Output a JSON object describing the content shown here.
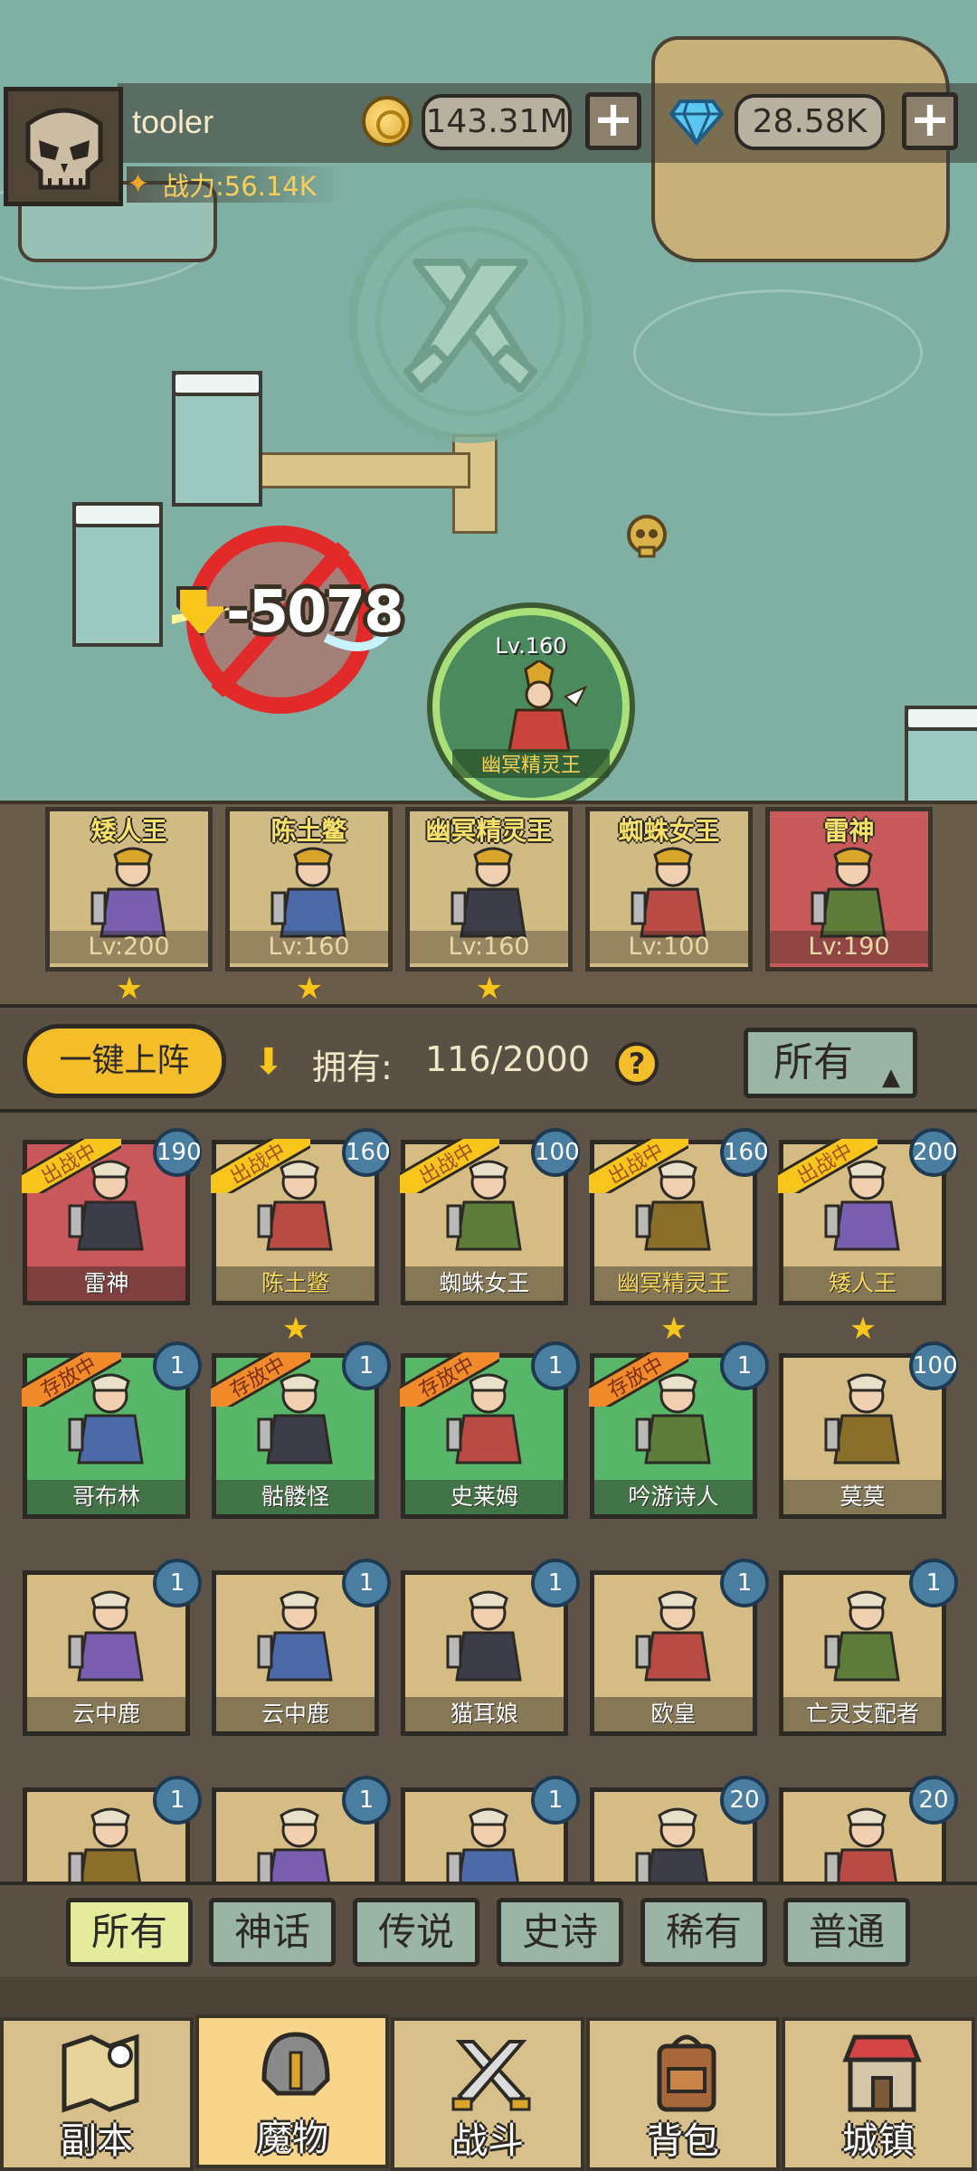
{
  "player": {
    "name": "tooler",
    "power_label": "战力:56.14K",
    "gold": "143.31M",
    "gems": "28.58K"
  },
  "battle": {
    "damage": "-5078",
    "enemy_level": "Lv.160",
    "enemy_name": "幽冥精灵王"
  },
  "team": [
    {
      "name": "矮人王",
      "level": "Lv:200",
      "color": "#d1bb84",
      "star": true
    },
    {
      "name": "陈土鳖",
      "level": "Lv:160",
      "color": "#d1bb84",
      "star": true
    },
    {
      "name": "幽冥精灵王",
      "level": "Lv:160",
      "color": "#d1bb84",
      "star": true
    },
    {
      "name": "蜘蛛女王",
      "level": "Lv:100",
      "color": "#d1bb84",
      "star": false
    },
    {
      "name": "雷神",
      "level": "Lv:190",
      "color": "#c95a5c",
      "star": false
    }
  ],
  "toolbar": {
    "deploy_label": "一键上阵",
    "own_label": "拥有:",
    "own_count": "116/2000",
    "help": "?",
    "filter_label": "所有"
  },
  "roster": [
    {
      "name": "雷神",
      "level": "190",
      "status": "出战中",
      "color": "red",
      "star": false
    },
    {
      "name": "陈土鳖",
      "level": "160",
      "status": "出战中",
      "color": "gold",
      "star": true,
      "gold_name": true
    },
    {
      "name": "蜘蛛女王",
      "level": "100",
      "status": "出战中",
      "color": "gold",
      "star": false
    },
    {
      "name": "幽冥精灵王",
      "level": "160",
      "status": "出战中",
      "color": "gold",
      "star": true,
      "gold_name": true
    },
    {
      "name": "矮人王",
      "level": "200",
      "status": "出战中",
      "color": "gold",
      "star": true,
      "gold_name": true
    },
    {
      "name": "哥布林",
      "level": "1",
      "status": "存放中",
      "color": "green",
      "star": false
    },
    {
      "name": "骷髅怪",
      "level": "1",
      "status": "存放中",
      "color": "green",
      "star": false
    },
    {
      "name": "史莱姆",
      "level": "1",
      "status": "存放中",
      "color": "green",
      "star": false
    },
    {
      "name": "吟游诗人",
      "level": "1",
      "status": "存放中",
      "color": "green",
      "star": false
    },
    {
      "name": "莫莫",
      "level": "100",
      "status": "",
      "color": "gold",
      "star": false
    },
    {
      "name": "云中鹿",
      "level": "1",
      "status": "",
      "color": "gold",
      "star": false
    },
    {
      "name": "云中鹿",
      "level": "1",
      "status": "",
      "color": "gold",
      "star": false
    },
    {
      "name": "猫耳娘",
      "level": "1",
      "status": "",
      "color": "gold",
      "star": false
    },
    {
      "name": "欧皇",
      "level": "1",
      "status": "",
      "color": "gold",
      "star": false
    },
    {
      "name": "亡灵支配者",
      "level": "1",
      "status": "",
      "color": "gold",
      "star": false
    },
    {
      "name": "",
      "level": "1",
      "status": "",
      "color": "gold",
      "star": false
    },
    {
      "name": "",
      "level": "1",
      "status": "",
      "color": "gold",
      "star": false
    },
    {
      "name": "",
      "level": "1",
      "status": "",
      "color": "gold",
      "star": false
    },
    {
      "name": "",
      "level": "20",
      "status": "",
      "color": "gold",
      "star": false
    },
    {
      "name": "",
      "level": "20",
      "status": "",
      "color": "gold",
      "star": false
    }
  ],
  "rarity_tabs": [
    "所有",
    "神话",
    "传说",
    "史诗",
    "稀有",
    "普通"
  ],
  "rarity_active": 0,
  "nav": [
    {
      "label": "副本",
      "icon": "map-icon"
    },
    {
      "label": "魔物",
      "icon": "helmet-icon"
    },
    {
      "label": "战斗",
      "icon": "crossed-swords-icon"
    },
    {
      "label": "背包",
      "icon": "backpack-icon"
    },
    {
      "label": "城镇",
      "icon": "shop-icon"
    }
  ],
  "nav_active": 1
}
